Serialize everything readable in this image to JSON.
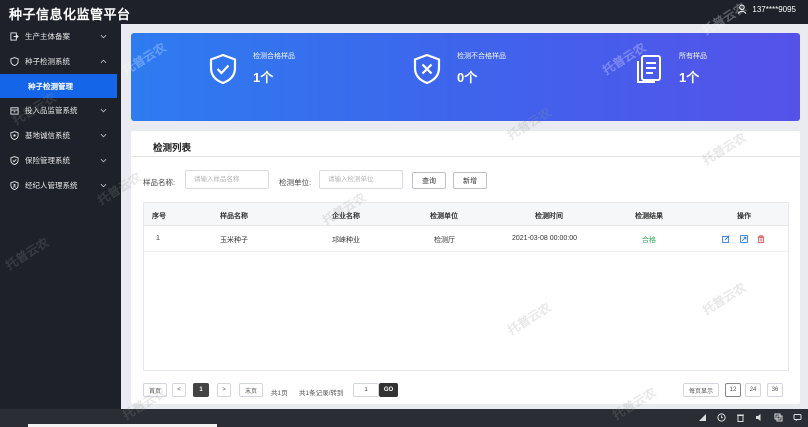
{
  "header": {
    "title": "种子信息化监管平台",
    "user": "137****9095"
  },
  "sidebar": {
    "items": [
      {
        "label": "生产主体备案",
        "icon": "logout-box-icon"
      },
      {
        "label": "种子检测系统",
        "icon": "shield-icon",
        "expanded": true
      },
      {
        "label": "投入品监管系统",
        "icon": "box-icon"
      },
      {
        "label": "基地诚信系统",
        "icon": "shield-icon"
      },
      {
        "label": "保险管理系统",
        "icon": "shield-check-icon"
      },
      {
        "label": "经纪人管理系统",
        "icon": "shield-icon"
      }
    ],
    "active_sub": "种子检测管理"
  },
  "stats": [
    {
      "label": "检测合格样品",
      "value": "1个",
      "icon": "shield-check-icon"
    },
    {
      "label": "检测不合格样品",
      "value": "0个",
      "icon": "shield-x-icon"
    },
    {
      "label": "所有样品",
      "value": "1个",
      "icon": "documents-icon"
    }
  ],
  "list": {
    "title": "检测列表",
    "filters": {
      "sample_label": "样品名称:",
      "sample_placeholder": "请输入样品名称",
      "unit_label": "检测单位:",
      "unit_placeholder": "请输入检测单位",
      "search_btn": "查询",
      "add_btn": "新增"
    },
    "columns": [
      "序号",
      "样品名称",
      "企业名称",
      "检测单位",
      "检测时间",
      "检测结果",
      "操作"
    ],
    "rows": [
      {
        "no": "1",
        "sample": "玉米种子",
        "company": "邛崃种业",
        "unit": "检测厅",
        "time": "2021-03-08 00:00:00",
        "result": "合格"
      }
    ],
    "actions": [
      "edit-icon",
      "view-icon",
      "delete-icon"
    ]
  },
  "pagination": {
    "first": "首页",
    "prev": "<",
    "current": "1",
    "next": ">",
    "last": "末页",
    "total_pages": "共1页",
    "total_records": "共1条记录/转到",
    "goto_value": "1",
    "go": "GO",
    "per_page_label": "每页显示",
    "sizes": [
      "12",
      "24",
      "36"
    ]
  },
  "watermark": "托普云农",
  "colors": {
    "sidebar_bg": "#1e2129",
    "active_blue": "#1565e8",
    "banner_start": "#2e7cf0",
    "banner_end": "#5552ea",
    "pass_green": "#2aa853",
    "delete_red": "#e05a5a"
  }
}
